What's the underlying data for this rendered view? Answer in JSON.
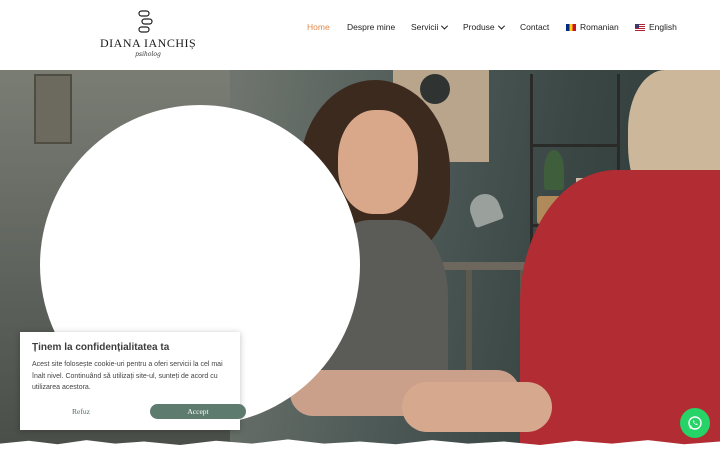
{
  "logo": {
    "name": "DIANA IANCHIȘ",
    "subtitle": "psiholog"
  },
  "nav": {
    "items": [
      {
        "label": "Home",
        "active": true
      },
      {
        "label": "Despre mine"
      },
      {
        "label": "Servicii",
        "has_dropdown": true
      },
      {
        "label": "Produse",
        "has_dropdown": true
      },
      {
        "label": "Contact"
      },
      {
        "label": "Romanian",
        "flag": "ro-flag-icon"
      },
      {
        "label": "English",
        "flag": "en-flag-icon"
      }
    ]
  },
  "cookie": {
    "title": "Ținem la confidențialitatea ta",
    "text": "Acest site folosește cookie-uri pentru a oferi servicii la cel mai înalt nivel. Continuând să utilizați site-ul, sunteți de acord cu utilizarea acestora.",
    "refuse_label": "Refuz",
    "accept_label": "Accept"
  },
  "colors": {
    "accent": "#e08a4a",
    "button": "#5d7c6f",
    "whatsapp": "#25d366"
  },
  "icons": {
    "whatsapp": "whatsapp-icon"
  }
}
